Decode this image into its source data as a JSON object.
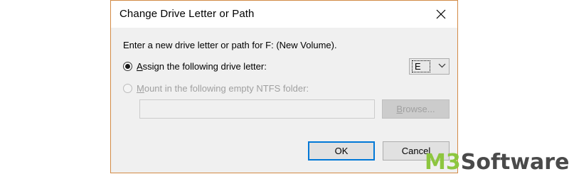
{
  "dialog": {
    "title": "Change Drive Letter or Path",
    "close_icon": "close-icon",
    "instruction": "Enter a new drive letter or path for F: (New Volume).",
    "assign_option": {
      "label_underlined": "A",
      "label_rest": "ssign the following drive letter:",
      "checked": true
    },
    "drive_letter_select": {
      "value": "E",
      "arrow_icon": "chevron-down-icon"
    },
    "mount_option": {
      "label_underlined": "M",
      "label_rest": "ount in the following empty NTFS folder:",
      "checked": false,
      "disabled": true
    },
    "folder_path": {
      "value": ""
    },
    "browse_button": {
      "label_underlined": "B",
      "label_rest": "rowse..."
    },
    "ok_button": "OK",
    "cancel_button": "Cancel"
  },
  "watermark": {
    "prefix": "M3",
    "rest": "Software"
  },
  "colors": {
    "dialog_border": "#d28a45",
    "accent": "#0078d7",
    "watermark_green": "#8dc63f",
    "watermark_gray": "#4a4a4a"
  }
}
